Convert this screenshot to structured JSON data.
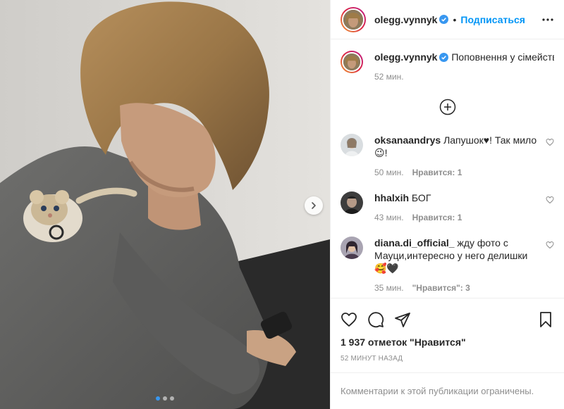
{
  "author": {
    "username": "olegg.vynnyk",
    "follow_label": "Подписаться",
    "separator": "•"
  },
  "caption": {
    "username": "olegg.vynnyk",
    "text": "Поповнення у сімействі котів",
    "time": "52 мин."
  },
  "comments": [
    {
      "username": "oksanaandrys",
      "text": "Лапушок♥! Так мило😉!",
      "time": "50 мин.",
      "likes": "Нравится: 1"
    },
    {
      "username": "hhalxih",
      "text": "БОГ",
      "time": "43 мин.",
      "likes": "Нравится: 1"
    },
    {
      "username": "diana.di_official_",
      "text": "жду фото с Мауци,интересно у него делишки🥰🖤",
      "time": "35 мин.",
      "likes": "\"Нравится\": 3"
    }
  ],
  "post": {
    "likes_count": "1 937 отметок \"Нравится\"",
    "time_ago": "52 минут назад",
    "comments_restricted": "Комментарии к этой публикации ограничены."
  },
  "carousel": {
    "total": 3,
    "active": 1
  },
  "colors": {
    "accent": "#0095f6",
    "verified": "#3897f0",
    "muted": "#8e8e8e"
  },
  "icons": [
    "verified-icon",
    "more-icon",
    "plus-circle-icon",
    "heart-icon",
    "comment-icon",
    "share-icon",
    "bookmark-icon",
    "chevron-right-icon"
  ]
}
